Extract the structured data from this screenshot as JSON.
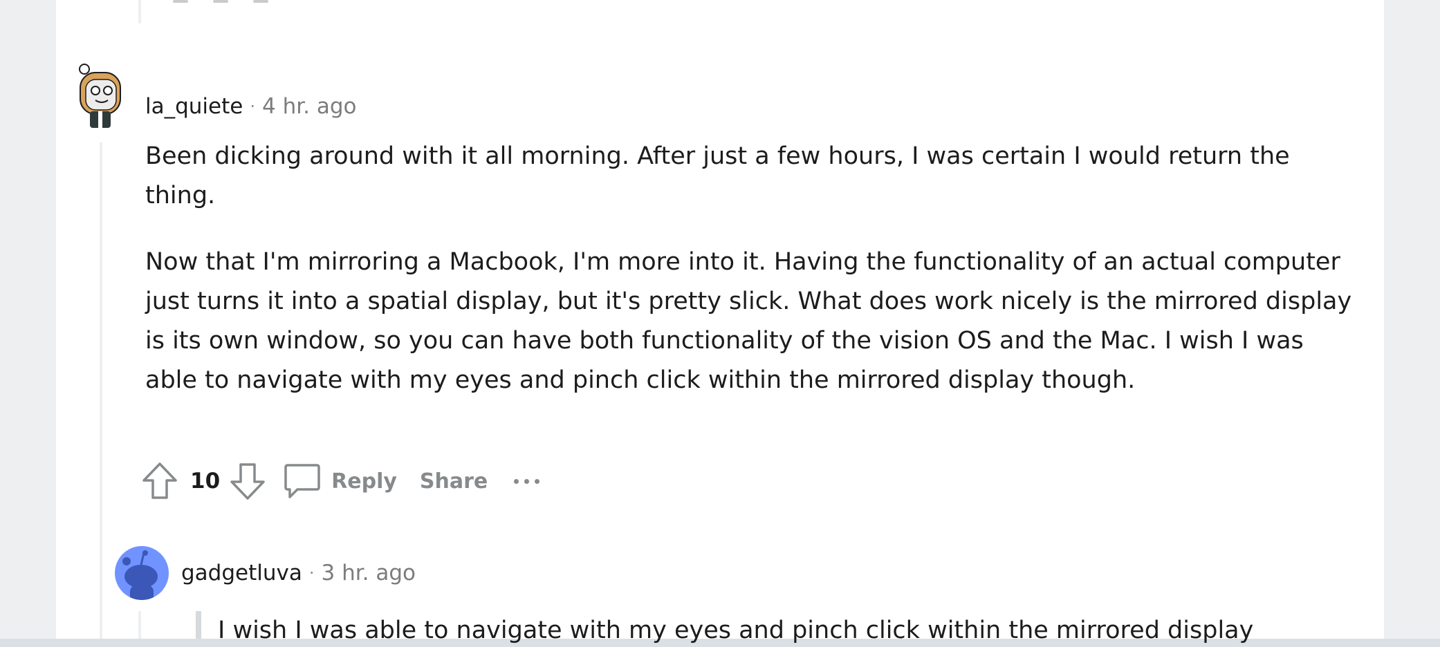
{
  "comments": [
    {
      "author": "la_quiete",
      "separator": "·",
      "time": "4 hr. ago",
      "paragraphs": [
        "Been dicking around with it all morning. After just a few hours, I was certain I would return the thing.",
        "Now that I'm mirroring a Macbook, I'm more into it. Having the functionality of an actual computer just turns it into a spatial display, but it's pretty slick. What does work nicely is the mirrored display is its own window, so you can have both functionality of the vision OS and the Mac. I wish I was able to navigate with my eyes and pinch click within the mirrored display though."
      ],
      "votes": "10",
      "actions": {
        "reply": "Reply",
        "share": "Share"
      },
      "icons": [
        "upvote-icon",
        "downvote-icon",
        "comment-bubble-icon",
        "more-options-icon"
      ]
    },
    {
      "author": "gadgetluva",
      "separator": "·",
      "time": "3 hr. ago",
      "quote": "I wish I was able to navigate with my eyes and pinch click within the mirrored display"
    }
  ],
  "colors": {
    "page_bg": "#dae0e6",
    "panel_bg": "#ffffff",
    "thread_line": "#edeff1",
    "muted_text": "#878a8c",
    "text": "#1c1c1c",
    "snoo_avatar_bg": "#7193ff"
  }
}
